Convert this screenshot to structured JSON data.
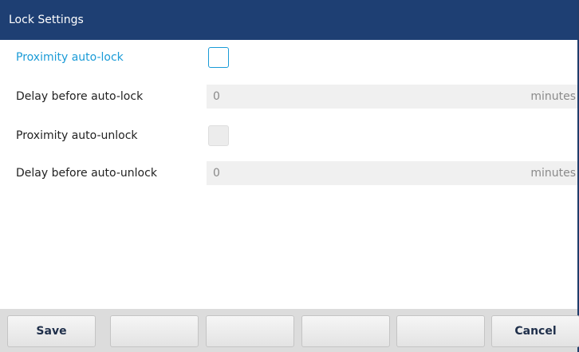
{
  "window": {
    "title": "Lock Settings"
  },
  "settings": [
    {
      "label": "Proximity auto-lock",
      "control": "checkbox",
      "checked": false,
      "state": "focused"
    },
    {
      "label": "Delay before auto-lock",
      "control": "number",
      "value": "0",
      "unit": "minutes"
    },
    {
      "label": "Proximity auto-unlock",
      "control": "checkbox",
      "checked": false,
      "state": "disabled"
    },
    {
      "label": "Delay before auto-unlock",
      "control": "number",
      "value": "0",
      "unit": "minutes"
    }
  ],
  "softkeys": {
    "save": "Save",
    "key2": "",
    "key3": "",
    "key4": "",
    "key5": "",
    "cancel": "Cancel"
  },
  "colors": {
    "title_bar": "#1e3f73",
    "focus_accent": "#1a9bd7",
    "softkey_text": "#1f2f4a"
  }
}
